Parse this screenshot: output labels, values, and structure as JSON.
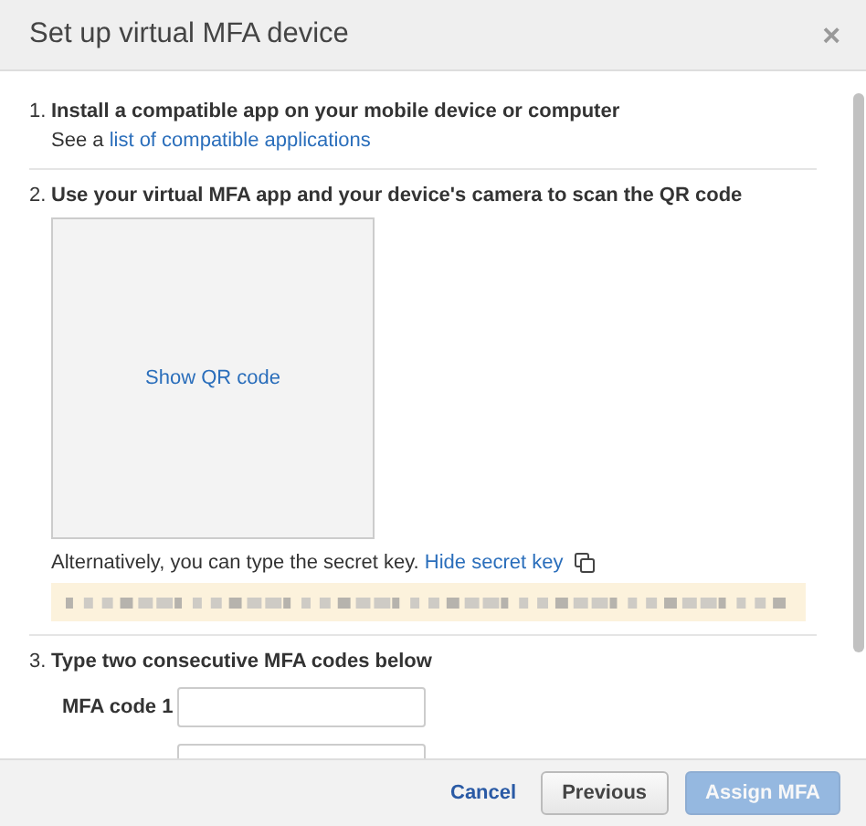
{
  "dialog": {
    "title": "Set up virtual MFA device",
    "close": "×"
  },
  "steps": [
    {
      "number": "1.",
      "heading": "Install a compatible app on your mobile device or computer",
      "note_prefix": "See a",
      "note_link": "list of compatible applications"
    },
    {
      "number": "2.",
      "heading": "Use your virtual MFA app and your device's camera to scan the QR code",
      "qr_link": "Show QR code",
      "alt_text": "Alternatively, you can type the secret key.",
      "alt_link": "Hide secret key",
      "secret_redacted": true
    },
    {
      "number": "3.",
      "heading": "Type two consecutive MFA codes below",
      "fields": [
        {
          "kind": "labeled",
          "label": "MFA code 1"
        },
        {
          "kind": "cut_off"
        }
      ]
    }
  ],
  "buttons": [
    {
      "label": "Cancel",
      "kind": "link",
      "disabled": false
    },
    {
      "label": "Previous",
      "kind": "secondary",
      "disabled": false
    },
    {
      "label": "Assign MFA",
      "kind": "primary",
      "disabled": true
    }
  ]
}
